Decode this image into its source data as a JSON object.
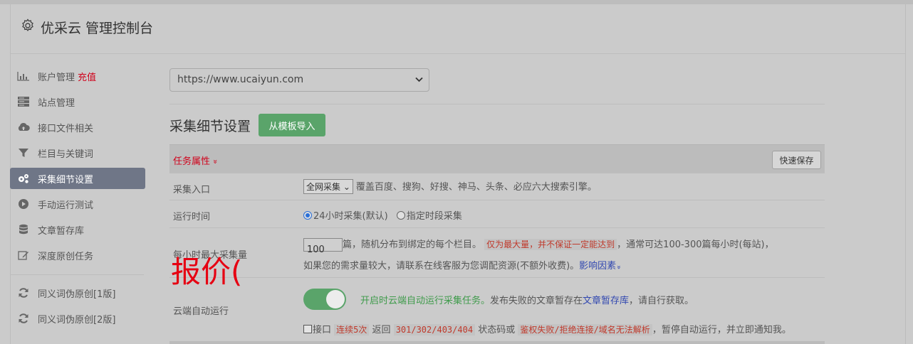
{
  "header": {
    "title": "优采云 管理控制台"
  },
  "sidebar": {
    "items": [
      {
        "label": "账户管理",
        "extra": "充值",
        "icon": "bar-chart-icon"
      },
      {
        "label": "站点管理",
        "icon": "server-icon"
      },
      {
        "label": "接口文件相关",
        "icon": "cloud-upload-icon"
      },
      {
        "label": "栏目与关键词",
        "icon": "filter-icon"
      },
      {
        "label": "采集细节设置",
        "icon": "gears-icon",
        "active": true
      },
      {
        "label": "手动运行测试",
        "icon": "play-circle-icon"
      },
      {
        "label": "文章暂存库",
        "icon": "database-icon"
      },
      {
        "label": "深度原创任务",
        "icon": "edit-icon"
      },
      {
        "label": "同义词伪原创[1版]",
        "icon": "refresh-icon"
      },
      {
        "label": "同义词伪原创[2版]",
        "icon": "refresh-icon"
      }
    ]
  },
  "main": {
    "site_select": "https://www.ucaiyun.com",
    "section_title": "采集细节设置",
    "import_button": "从模板导入",
    "task_props_label": "任务属性",
    "task_props_chevron": "»",
    "quick_save": "快速保存",
    "rows": {
      "entry": {
        "label": "采集入口",
        "select_value": "全网采集",
        "desc": "覆盖百度、搜狗、好搜、神马、头条、必应六大搜索引擎。"
      },
      "runtime": {
        "label": "运行时间",
        "option1": "24小时采集(默认)",
        "option2": "指定时段采集"
      },
      "max_per_hour": {
        "label": "每小时最大采集量",
        "value": "100",
        "line1_a": "篇，随机分布到绑定的每个栏目。",
        "line1_code": "仅为最大量，并不保证一定能达到",
        "line1_b": "，通常可达100-300篇每小时(每站)，",
        "line2_a": "如果您的需求量较大，请联系在线客服为您调配资源(不额外收费)。",
        "line2_link": "影响因素",
        "line2_chevron": "»"
      },
      "cloud_auto": {
        "label": "云端自动运行",
        "green_text": "开启时云端自动运行采集任务。",
        "desc_a": "发布失败的文章暂存在",
        "desc_link": "文章暂存库",
        "desc_b": "，请自行获取。",
        "chk_label": "接口",
        "code1": "连续5次",
        "t1": "返回",
        "code2": "301/302/403/404",
        "t2": "状态码或",
        "code3": "鉴权失败/拒绝连接/域名无法解析",
        "t3": "，暂停自动运行，并立即通知我。"
      }
    }
  },
  "overlay": {
    "text": "报价("
  },
  "colors": {
    "accent_green": "#5aa46a",
    "alert_red": "#d0021b",
    "link_blue": "#3248b0",
    "active_sidebar": "#6f7687"
  }
}
